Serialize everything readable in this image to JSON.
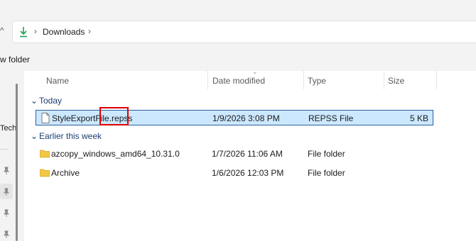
{
  "address": {
    "breadcrumb": "Downloads",
    "icon": "download-arrow-icon"
  },
  "command_bar": {
    "new_folder_label": "w folder"
  },
  "nav": {
    "partial_label": "Tech"
  },
  "columns": {
    "name": "Name",
    "date_modified": "Date modified",
    "type": "Type",
    "size": "Size"
  },
  "groups": [
    {
      "label": "Today",
      "items": [
        {
          "name": "StyleExportFile.repss",
          "date": "1/9/2026 3:08 PM",
          "type": "REPSS File",
          "size": "5 KB",
          "icon": "file-icon",
          "selected": true
        }
      ]
    },
    {
      "label": "Earlier this week",
      "items": [
        {
          "name": "azcopy_windows_amd64_10.31.0",
          "date": "1/7/2026 11:06 AM",
          "type": "File folder",
          "size": "",
          "icon": "folder-icon"
        },
        {
          "name": "Archive",
          "date": "1/6/2026 12:03 PM",
          "type": "File folder",
          "size": "",
          "icon": "folder-icon"
        }
      ]
    }
  ],
  "colors": {
    "selection_bg": "#cce8ff",
    "selection_border": "#2b5f9e",
    "group_text": "#1b3f72",
    "folder": "#f2c744",
    "annotation": "#e00000"
  }
}
